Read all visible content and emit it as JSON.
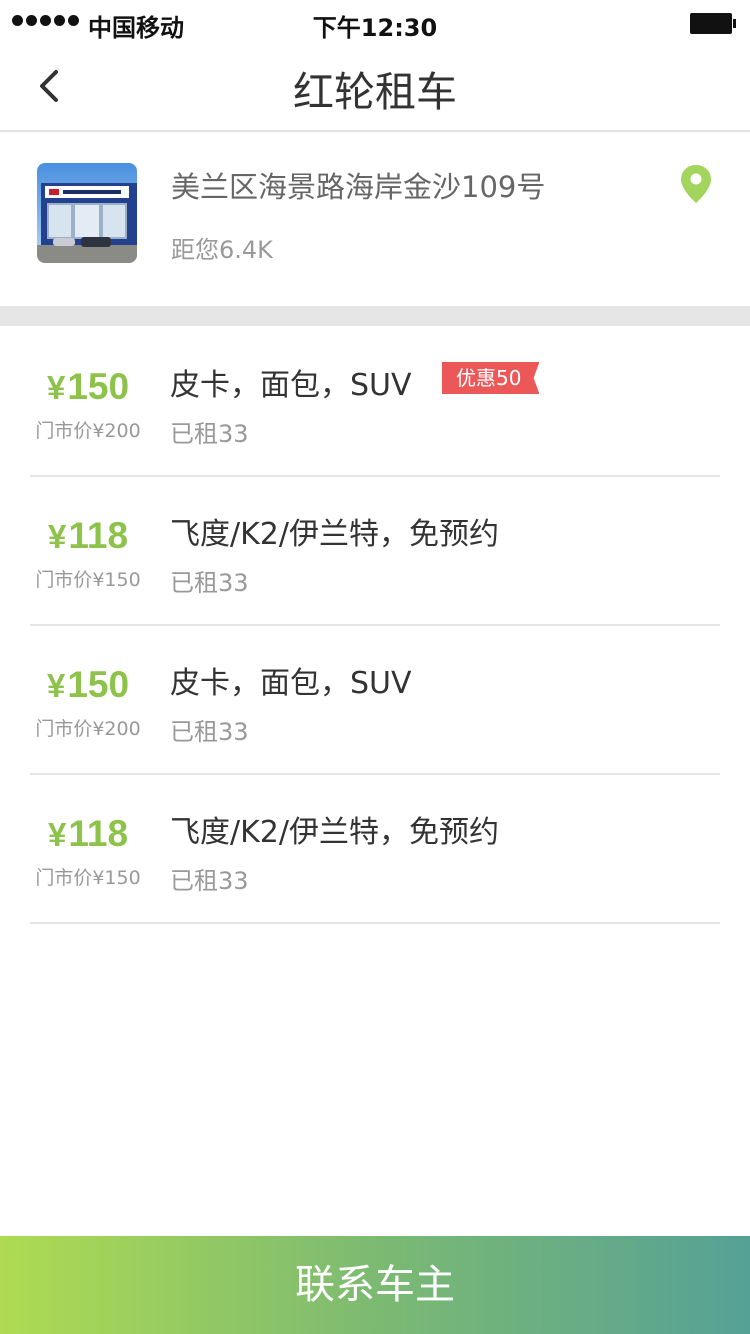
{
  "status_bar": {
    "carrier": "中国移动",
    "time": "下午12:30"
  },
  "nav": {
    "title": "红轮租车",
    "back_icon": "chevron-left-icon"
  },
  "store": {
    "address": "美兰区海景路海岸金沙109号",
    "distance": "距您6.4K",
    "location_icon": "map-pin-icon",
    "accent_color": "#a2d45e"
  },
  "listings": [
    {
      "price_symbol": "¥",
      "price": "150",
      "original_price": "门市价¥200",
      "name": "皮卡，面包，SUV",
      "rented": "已租33",
      "badge": "优惠50"
    },
    {
      "price_symbol": "¥",
      "price": "118",
      "original_price": "门市价¥150",
      "name": "飞度/K2/伊兰特，免预约",
      "rented": "已租33",
      "badge": ""
    },
    {
      "price_symbol": "¥",
      "price": "150",
      "original_price": "门市价¥200",
      "name": "皮卡，面包，SUV",
      "rented": "已租33",
      "badge": ""
    },
    {
      "price_symbol": "¥",
      "price": "118",
      "original_price": "门市价¥150",
      "name": "飞度/K2/伊兰特，免预约",
      "rented": "已租33",
      "badge": ""
    }
  ],
  "colors": {
    "price_green": "#8dc34a",
    "badge_red": "#ec5758",
    "button_gradient_start": "#aedb52",
    "button_gradient_end": "#55a196"
  },
  "footer": {
    "contact_label": "联系车主"
  }
}
